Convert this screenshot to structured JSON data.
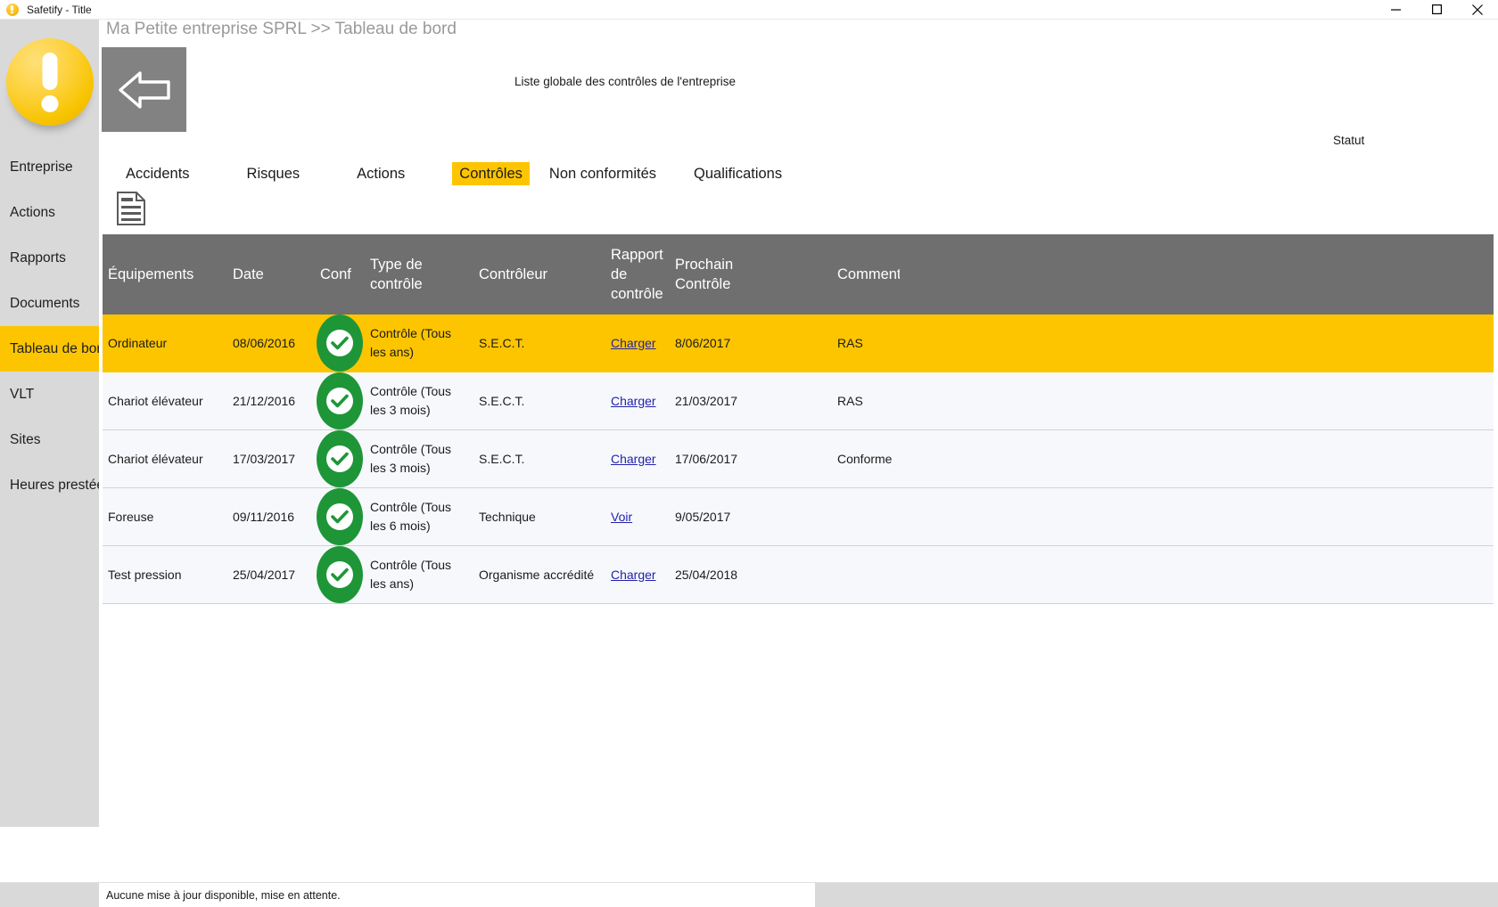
{
  "window": {
    "title": "Safetify - Title",
    "icon": "safetify-logo-icon",
    "minimize_label": "─",
    "maximize_label": "❐",
    "close_label": "✕"
  },
  "sidebar": {
    "logo_name": "safetify-logo",
    "items": [
      {
        "label": "Entreprise",
        "active": false
      },
      {
        "label": "Actions",
        "active": false
      },
      {
        "label": "Rapports",
        "active": false
      },
      {
        "label": "Documents",
        "active": false
      },
      {
        "label": "Tableau de bord",
        "active": true
      },
      {
        "label": "VLT",
        "active": false
      },
      {
        "label": "Sites",
        "active": false
      },
      {
        "label": "Heures prestée(s)",
        "active": false
      }
    ]
  },
  "header": {
    "breadcrumb": "Ma Petite entreprise SPRL >> Tableau de bord",
    "back_button_label": "Retour",
    "global_title": "Liste globale des contrôles de l'entreprise",
    "statut_label": "Statut"
  },
  "tabs": [
    {
      "label": "Accidents",
      "active": false
    },
    {
      "label": "Risques",
      "active": false
    },
    {
      "label": "Actions",
      "active": false
    },
    {
      "label": "Contrôles",
      "active": true
    },
    {
      "label": "Non conformités",
      "active": false
    },
    {
      "label": "Qualifications",
      "active": false
    }
  ],
  "toolbar": {
    "export_icon": "document-export-icon"
  },
  "table": {
    "headers": [
      "Équipements",
      "Date",
      "Conf",
      "Type de contrôle",
      "Contrôleur",
      "Rapport de contrôle",
      "Prochain Contrôle",
      "Commentaires"
    ],
    "rows": [
      {
        "equipement": "Ordinateur",
        "date": "08/06/2016",
        "conforme": "conforme-check-icon",
        "type": "Contrôle (Tous les ans)",
        "controleur": "S.E.C.T.",
        "rapport": "Charger",
        "prochain": "8/06/2017",
        "commentaire": "RAS",
        "highlight": true
      },
      {
        "equipement": "Chariot élévateur",
        "date": "21/12/2016",
        "conforme": "conforme-check-icon",
        "type": "Contrôle (Tous les 3 mois)",
        "controleur": "S.E.C.T.",
        "rapport": "Charger",
        "prochain": "21/03/2017",
        "commentaire": "RAS",
        "highlight": false
      },
      {
        "equipement": "Chariot élévateur",
        "date": "17/03/2017",
        "conforme": "conforme-check-icon",
        "type": "Contrôle (Tous les 3 mois)",
        "controleur": "S.E.C.T.",
        "rapport": "Charger",
        "prochain": "17/06/2017",
        "commentaire": "Conforme",
        "highlight": false
      },
      {
        "equipement": "Foreuse",
        "date": "09/11/2016",
        "conforme": "conforme-check-icon",
        "type": "Contrôle (Tous les 6 mois)",
        "controleur": "Technique",
        "rapport": "Voir",
        "prochain": "9/05/2017",
        "commentaire": "",
        "highlight": false
      },
      {
        "equipement": "Test pression",
        "date": "25/04/2017",
        "conforme": "conforme-check-icon",
        "type": "Contrôle (Tous les ans)",
        "controleur": "Organisme accrédité",
        "rapport": "Charger",
        "prochain": "25/04/2018",
        "commentaire": "",
        "highlight": false
      }
    ]
  },
  "statusbar": {
    "message": "Aucune mise à jour disponible, mise en attente."
  },
  "colors": {
    "accent_yellow": "#fdc500",
    "sidebar_gray": "#d9d9d9",
    "header_gray": "#6f6f6f",
    "check_green": "#1e9638",
    "link_blue": "#2222aa"
  }
}
